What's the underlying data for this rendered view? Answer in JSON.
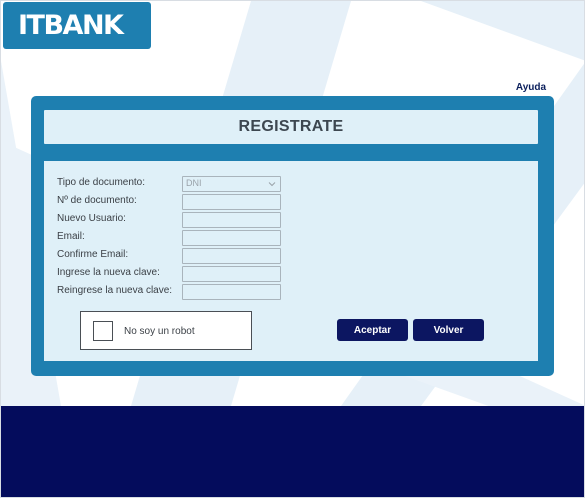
{
  "brand": {
    "logo_text": "ITBANK",
    "logo_color": "#1e7fb0"
  },
  "header": {
    "help_label": "Ayuda"
  },
  "form": {
    "title": "REGISTRATE",
    "fields": [
      {
        "label": "Tipo de documento:",
        "type": "select",
        "value": "DNI"
      },
      {
        "label": "Nº de documento:",
        "type": "text",
        "value": ""
      },
      {
        "label": "Nuevo Usuario:",
        "type": "text",
        "value": ""
      },
      {
        "label": "Email:",
        "type": "text",
        "value": ""
      },
      {
        "label": "Confirme Email:",
        "type": "text",
        "value": ""
      },
      {
        "label": "Ingrese la nueva clave:",
        "type": "password",
        "value": ""
      },
      {
        "label": "Reingrese la nueva clave:",
        "type": "password",
        "value": ""
      }
    ],
    "captcha_label": "No soy un robot",
    "captcha_checked": false,
    "accept_label": "Aceptar",
    "back_label": "Volver"
  },
  "colors": {
    "panel": "#1e7fb0",
    "panel_inner": "#dff0f8",
    "button": "#0c1661",
    "footer": "#040c5c"
  }
}
